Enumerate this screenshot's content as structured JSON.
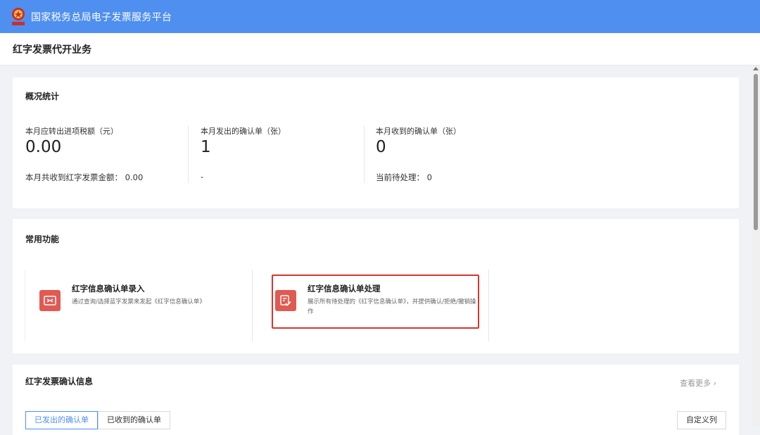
{
  "header": {
    "app_title": "国家税务总局电子发票服务平台"
  },
  "page": {
    "title": "红字发票代开业务"
  },
  "overview": {
    "title": "概况统计",
    "stats": [
      {
        "label": "本月应转出进项税额（元）",
        "value": "0.00",
        "foot": "本月共收到红字发票金额：  0.00"
      },
      {
        "label": "本月发出的确认单（张）",
        "value": "1",
        "foot": "-"
      },
      {
        "label": "本月收到的确认单（张）",
        "value": "0",
        "foot": "当前待处理：  0"
      }
    ]
  },
  "functions": {
    "title": "常用功能",
    "items": [
      {
        "name": "红字信息确认单录入",
        "desc": "通过查询/选择蓝字发票来发起《红字信息确认单》",
        "icon": "swap-arrows-icon"
      },
      {
        "name": "红字信息确认单处理",
        "desc": "展示所有待处理的《红字信息确认单》，并提供确认/拒绝/撤销操作",
        "icon": "document-check-icon"
      }
    ]
  },
  "confirm_info": {
    "title": "红字发票确认信息",
    "view_more": "查看更多",
    "tabs": [
      {
        "label": "已发出的确认单"
      },
      {
        "label": "已收到的确认单"
      }
    ],
    "custom_columns": "自定义列"
  },
  "colors": {
    "header_bg": "#4f8ff0",
    "accent_red": "#e05a52",
    "highlight_border": "#d9342b"
  }
}
